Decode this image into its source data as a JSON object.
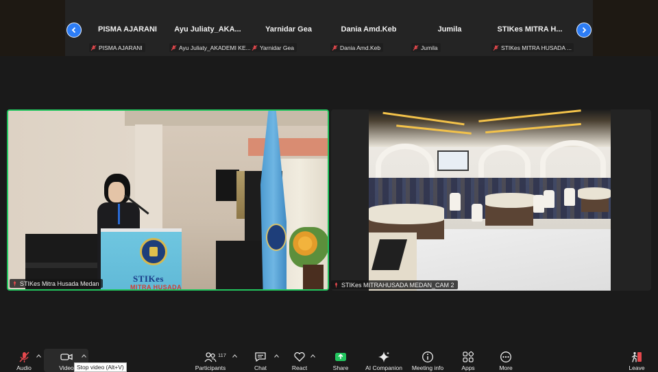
{
  "participants_strip": {
    "thumbnails": [
      {
        "name": "PISMA AJARANI",
        "tag": "PISMA AJARANI"
      },
      {
        "name": "Ayu Juliaty_AKA...",
        "tag": "Ayu Juliaty_AKADEMI KE..."
      },
      {
        "name": "Yarnidar Gea",
        "tag": "Yarnidar Gea"
      },
      {
        "name": "Dania Amd.Keb",
        "tag": "Dania Amd.Keb"
      },
      {
        "name": "Jumila",
        "tag": "Jumila"
      },
      {
        "name": "STIKes MITRA H...",
        "tag": "STIKes MITRA HUSADA ..."
      }
    ]
  },
  "video_tiles": {
    "left": {
      "label": "STIKes Mitra Husada Medan",
      "podium_text": "STIKes",
      "podium_subtext": "MITRA HUSADA",
      "active_speaker": true
    },
    "right": {
      "label": "STIKes MITRAHUSADA MEDAN_CAM 2"
    }
  },
  "toolbar": {
    "audio": "Audio",
    "video": "Video",
    "video_tooltip": "Stop video (Alt+V)",
    "participants": "Participants",
    "participants_count": "117",
    "chat": "Chat",
    "react": "React",
    "share": "Share",
    "ai_companion": "AI Companion",
    "meeting_info": "Meeting info",
    "apps": "Apps",
    "more": "More",
    "leave": "Leave"
  },
  "colors": {
    "active_speaker_border": "#22c55e",
    "nav_arrow": "#2d7df6",
    "share_green": "#22c55e",
    "mic_muted_red": "#e5484d",
    "leave_red": "#e5484d"
  },
  "icons": [
    "chevron-left-icon",
    "chevron-right-icon",
    "mic-off-icon",
    "pin-icon",
    "mic-muted-icon",
    "video-camera-icon",
    "participants-icon",
    "chat-icon",
    "heart-icon",
    "share-arrow-icon",
    "sparkle-icon",
    "info-icon",
    "apps-icon",
    "more-icon",
    "leave-icon"
  ]
}
